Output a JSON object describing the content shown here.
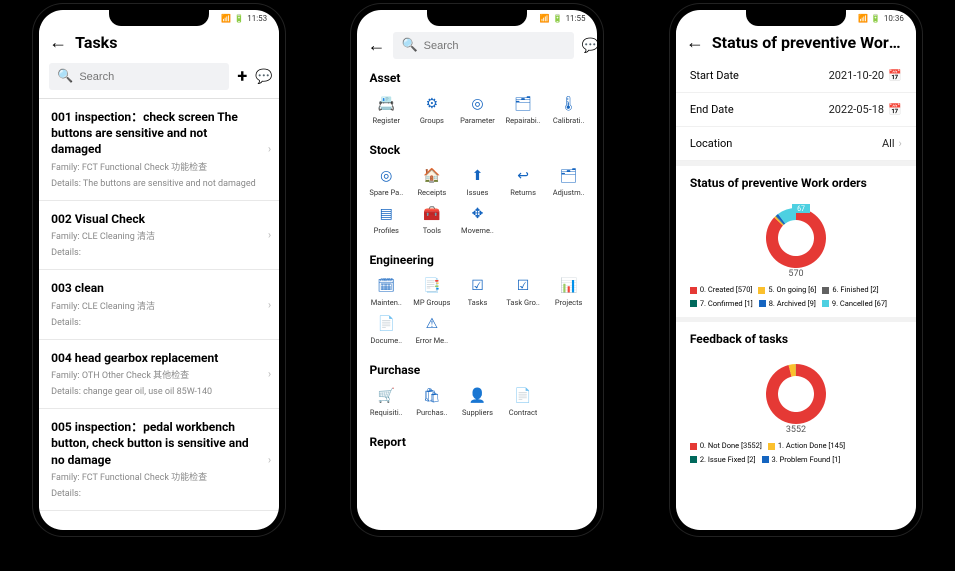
{
  "phone1": {
    "status_time": "11:53",
    "title": "Tasks",
    "search_placeholder": "Search",
    "tasks": [
      {
        "title": "001 inspection：check screen The buttons are sensitive and not damaged",
        "family": "Family: FCT Functional Check 功能检查",
        "details": "Details: The buttons are sensitive and not damaged"
      },
      {
        "title": "002 Visual Check",
        "family": "Family: CLE Cleaning 清洁",
        "details": "Details:"
      },
      {
        "title": "003 clean",
        "family": "Family: CLE Cleaning 清洁",
        "details": "Details:"
      },
      {
        "title": "004 head gearbox replacement",
        "family": "Family: OTH Other Check 其他检查",
        "details": "Details: change gear oil, use oil 85W-140"
      },
      {
        "title": "005 inspection：pedal workbench button, check button is sensitive and no damage",
        "family": "Family: FCT Functional Check 功能检查",
        "details": "Details:"
      }
    ]
  },
  "phone2": {
    "status_time": "11:55",
    "search_placeholder": "Search",
    "sections": [
      {
        "label": "Asset",
        "items": [
          {
            "label": "Register",
            "icon": "📇"
          },
          {
            "label": "Groups",
            "icon": "⚙"
          },
          {
            "label": "Parameter",
            "icon": "◎"
          },
          {
            "label": "Repairabi..",
            "icon": "🗂"
          },
          {
            "label": "Calibrati..",
            "icon": "🌡"
          }
        ]
      },
      {
        "label": "Stock",
        "items": [
          {
            "label": "Spare Pa..",
            "icon": "◎"
          },
          {
            "label": "Receipts",
            "icon": "🏠"
          },
          {
            "label": "Issues",
            "icon": "⬆"
          },
          {
            "label": "Returns",
            "icon": "↩"
          },
          {
            "label": "Adjustm..",
            "icon": "🗂"
          },
          {
            "label": "Profiles",
            "icon": "▤"
          },
          {
            "label": "Tools",
            "icon": "🧰"
          },
          {
            "label": "Moveme..",
            "icon": "✥"
          }
        ]
      },
      {
        "label": "Engineering",
        "items": [
          {
            "label": "Mainten..",
            "icon": "🗓"
          },
          {
            "label": "MP Groups",
            "icon": "📑"
          },
          {
            "label": "Tasks",
            "icon": "☑"
          },
          {
            "label": "Task Gro..",
            "icon": "☑"
          },
          {
            "label": "Projects",
            "icon": "📊"
          },
          {
            "label": "Docume..",
            "icon": "📄"
          },
          {
            "label": "Error Me..",
            "icon": "⚠"
          }
        ]
      },
      {
        "label": "Purchase",
        "items": [
          {
            "label": "Requisiti..",
            "icon": "🛒"
          },
          {
            "label": "Purchas..",
            "icon": "🛍"
          },
          {
            "label": "Suppliers",
            "icon": "👤"
          },
          {
            "label": "Contract",
            "icon": "📄"
          }
        ]
      },
      {
        "label": "Report",
        "items": []
      }
    ]
  },
  "phone3": {
    "status_time": "10:36",
    "title": "Status of preventive Work …",
    "filters": {
      "start_label": "Start Date",
      "start_value": "2021-10-20",
      "end_label": "End Date",
      "end_value": "2022-05-18",
      "location_label": "Location",
      "location_value": "All"
    },
    "chart1": {
      "title": "Status of preventive Work orders",
      "center_label": "570",
      "top_label": "67"
    },
    "chart2": {
      "title": "Feedback of tasks",
      "center_label": "3552"
    },
    "legend1": [
      {
        "color": "#e53935",
        "text": "0. Created [570]"
      },
      {
        "color": "#fbc02d",
        "text": "5. On going [6]"
      },
      {
        "color": "#616161",
        "text": "6. Finished [2]"
      },
      {
        "color": "#00695c",
        "text": "7. Confirmed [1]"
      },
      {
        "color": "#1565c0",
        "text": "8. Archived [9]"
      },
      {
        "color": "#4dd0e1",
        "text": "9. Cancelled [67]"
      }
    ],
    "legend2": [
      {
        "color": "#e53935",
        "text": "0. Not Done [3552]"
      },
      {
        "color": "#fbc02d",
        "text": "1. Action Done [145]"
      },
      {
        "color": "#00695c",
        "text": "2. Issue Fixed [2]"
      },
      {
        "color": "#1565c0",
        "text": "3. Problem Found [1]"
      }
    ]
  },
  "chart_data": [
    {
      "type": "pie",
      "title": "Status of preventive Work orders",
      "series": [
        {
          "name": "0. Created",
          "value": 570,
          "color": "#e53935"
        },
        {
          "name": "5. On going",
          "value": 6,
          "color": "#fbc02d"
        },
        {
          "name": "6. Finished",
          "value": 2,
          "color": "#616161"
        },
        {
          "name": "7. Confirmed",
          "value": 1,
          "color": "#00695c"
        },
        {
          "name": "8. Archived",
          "value": 9,
          "color": "#1565c0"
        },
        {
          "name": "9. Cancelled",
          "value": 67,
          "color": "#4dd0e1"
        }
      ]
    },
    {
      "type": "pie",
      "title": "Feedback of tasks",
      "series": [
        {
          "name": "0. Not Done",
          "value": 3552,
          "color": "#e53935"
        },
        {
          "name": "1. Action Done",
          "value": 145,
          "color": "#fbc02d"
        },
        {
          "name": "2. Issue Fixed",
          "value": 2,
          "color": "#00695c"
        },
        {
          "name": "3. Problem Found",
          "value": 1,
          "color": "#1565c0"
        }
      ]
    }
  ]
}
